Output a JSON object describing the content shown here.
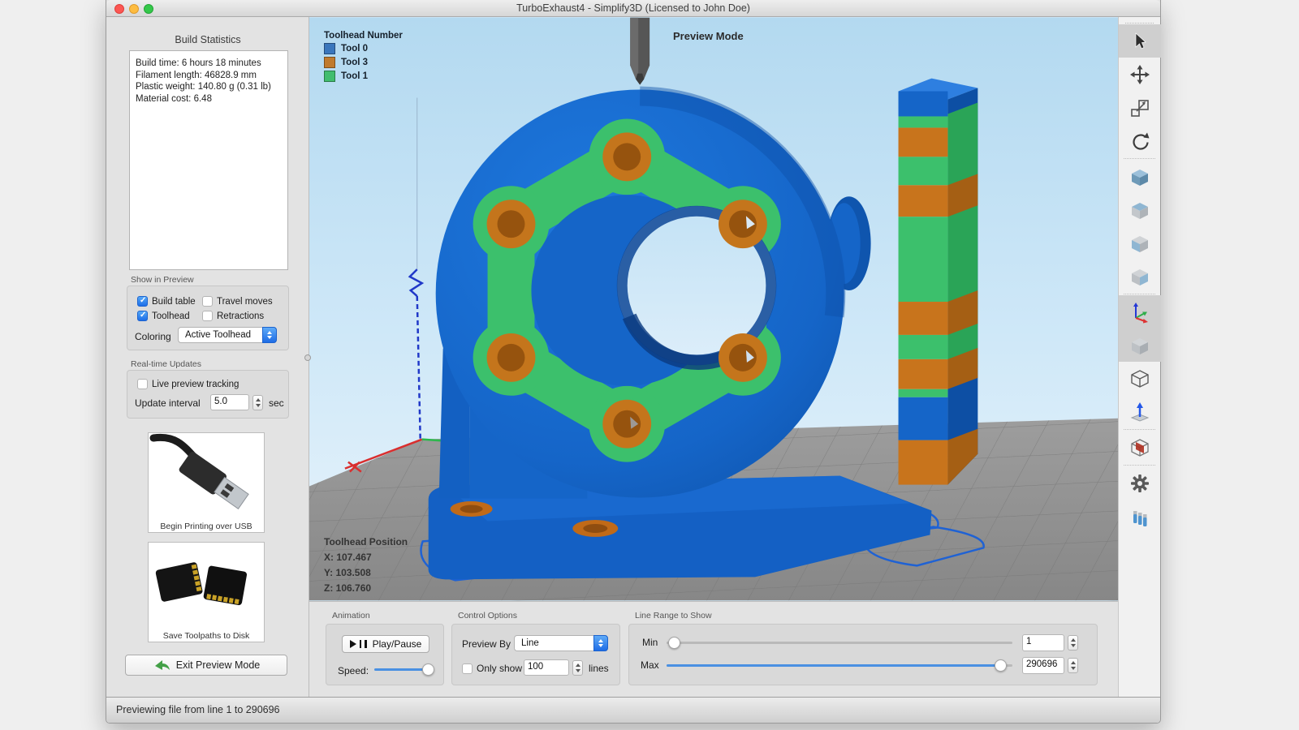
{
  "window": {
    "title": "TurboExhaust4 - Simplify3D (Licensed to John Doe)"
  },
  "left_panel": {
    "build_statistics": {
      "title": "Build Statistics",
      "lines": [
        "Build time: 6 hours 18 minutes",
        "Filament length: 46828.9 mm",
        "Plastic weight: 140.80 g (0.31 lb)",
        "Material cost: 6.48"
      ]
    },
    "show_in_preview": {
      "label": "Show in Preview",
      "items": [
        {
          "label": "Build table",
          "checked": true
        },
        {
          "label": "Travel moves",
          "checked": false
        },
        {
          "label": "Toolhead",
          "checked": true
        },
        {
          "label": "Retractions",
          "checked": false
        }
      ],
      "coloring_label": "Coloring",
      "coloring_value": "Active Toolhead"
    },
    "realtime": {
      "label": "Real-time Updates",
      "tracking_label": "Live preview tracking",
      "tracking_checked": false,
      "interval_label": "Update interval",
      "interval_value": "5.0",
      "interval_unit": "sec"
    },
    "usb_button_label": "Begin Printing over USB",
    "sd_button_label": "Save Toolpaths to Disk",
    "exit_button_label": "Exit Preview Mode"
  },
  "viewport": {
    "legend": {
      "title": "Toolhead Number",
      "items": [
        {
          "label": "Tool 0",
          "color": "#3a76bc"
        },
        {
          "label": "Tool 3",
          "color": "#c07a2d"
        },
        {
          "label": "Tool 1",
          "color": "#41bd6e"
        }
      ]
    },
    "mode_label": "Preview Mode",
    "toolhead_position": {
      "title": "Toolhead Position",
      "x": "X: 107.467",
      "y": "Y: 103.508",
      "z": "Z: 106.760"
    }
  },
  "controls": {
    "animation": {
      "label": "Animation",
      "play_label": "Play/Pause",
      "speed_label": "Speed:"
    },
    "control_options": {
      "label": "Control Options",
      "preview_by_label": "Preview By",
      "preview_by_value": "Line",
      "only_show_label": "Only show",
      "only_show_value": "100",
      "only_show_unit": "lines",
      "only_show_checked": false
    },
    "line_range": {
      "label": "Line Range to Show",
      "min_label": "Min",
      "min_value": "1",
      "max_label": "Max",
      "max_value": "290696"
    }
  },
  "toolbar": {
    "items": [
      "select-tool",
      "move-tool",
      "scale-tool",
      "rotate-view-tool",
      "view-default-cube",
      "view-top-cube",
      "view-front-cube",
      "view-side-cube",
      "show-axes",
      "render-solid-cube",
      "render-wireframe-cube",
      "show-normals",
      "cross-section",
      "machine-settings-gear",
      "toolpath-layers"
    ]
  },
  "status_bar": {
    "text": "Previewing file from line 1 to 290696"
  },
  "colors": {
    "tool0_blue": "#3a76bc",
    "tool3_orange": "#c07a2d",
    "tool1_green": "#41bd6e",
    "model_blue": "#1565c8",
    "flange_green": "#3cc06c",
    "bolt_orange": "#c4751c",
    "accent_blue": "#2f7ce0",
    "sky_top": "#b5daf0",
    "floor_gray": "#8f8f8f"
  }
}
